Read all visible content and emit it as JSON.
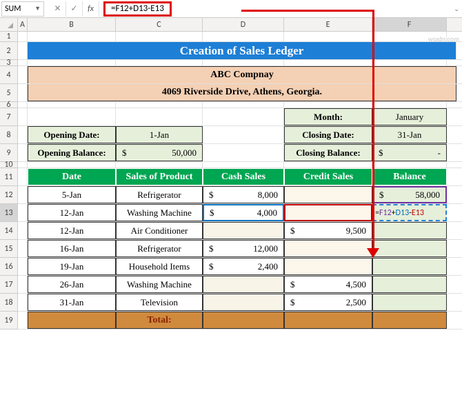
{
  "name_box": "SUM",
  "formula": "=F12+D13-E13",
  "columns": [
    "A",
    "B",
    "C",
    "D",
    "E",
    "F"
  ],
  "title": "Creation of Sales Ledger",
  "company_name": "ABC Compnay",
  "company_addr": "4069 Riverside Drive, Athens, Georgia.",
  "month_label": "Month:",
  "month_value": "January",
  "opening_date_label": "Opening Date:",
  "opening_date_value": "1-Jan",
  "closing_date_label": "Closing Date:",
  "closing_date_value": "31-Jan",
  "opening_balance_label": "Opening Balance:",
  "opening_balance_currency": "$",
  "opening_balance_value": "50,000",
  "closing_balance_label": "Closing Balance:",
  "closing_balance_currency": "$",
  "closing_balance_value": "-",
  "headers": {
    "date": "Date",
    "product": "Sales of Product",
    "cash": "Cash Sales",
    "credit": "Credit Sales",
    "balance": "Balance"
  },
  "rows": [
    {
      "date": "5-Jan",
      "product": "Refrigerator",
      "cash": "8,000",
      "credit": "",
      "balance": "58,000"
    },
    {
      "date": "12-Jan",
      "product": "Washing Machine",
      "cash": "4,000",
      "credit": "",
      "balance": "=F12+D13-E13"
    },
    {
      "date": "12-Jan",
      "product": "Air Conditioner",
      "cash": "",
      "credit": "9,500",
      "balance": ""
    },
    {
      "date": "16-Jan",
      "product": "Refrigerator",
      "cash": "12,000",
      "credit": "",
      "balance": ""
    },
    {
      "date": "19-Jan",
      "product": "Household Items",
      "cash": "2,400",
      "credit": "",
      "balance": ""
    },
    {
      "date": "26-Jan",
      "product": "Washing Machine",
      "cash": "",
      "credit": "4,500",
      "balance": ""
    },
    {
      "date": "31-Jan",
      "product": "Television",
      "cash": "",
      "credit": "2,500",
      "balance": ""
    }
  ],
  "total_label": "Total:",
  "currency": "$",
  "watermark": "wsxdn.com"
}
